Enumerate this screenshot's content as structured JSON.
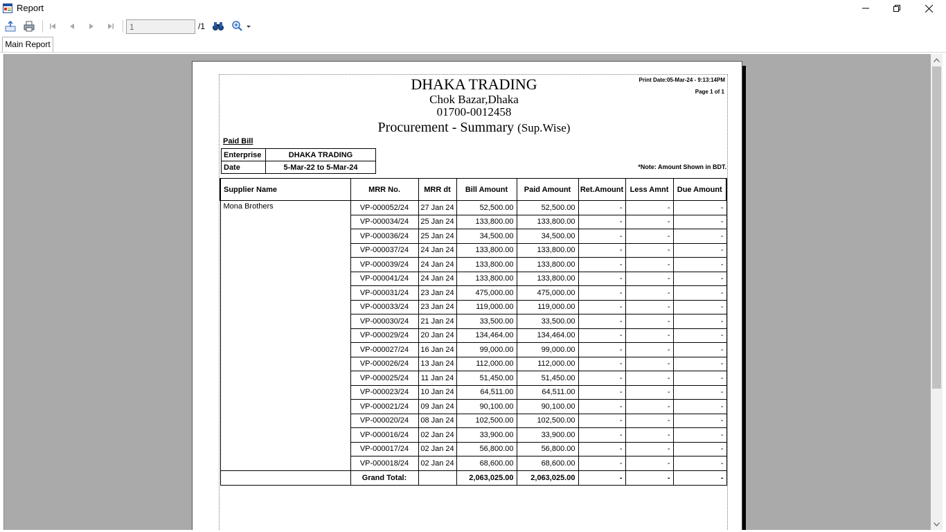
{
  "window": {
    "title": "Report"
  },
  "toolbar": {
    "page_value": "1",
    "page_total": "/1"
  },
  "tabs": [
    {
      "label": "Main Report"
    }
  ],
  "report": {
    "company_name": "DHAKA TRADING",
    "address": "Chok Bazar,Dhaka",
    "phone": "01700-0012458",
    "title_main": "Procurement - Summary",
    "title_sub": "(Sup.Wise)",
    "print_date": "Print Date:05-Mar-24 -  9:13:14PM",
    "page_of": "Page 1 of 1",
    "section_label": "Paid Bill",
    "enterprise_label": "Enterprise",
    "enterprise_value": "DHAKA TRADING",
    "date_label": "Date",
    "date_value": "5-Mar-22 to 5-Mar-24",
    "note": "*Note: Amount Shown in BDT.",
    "columns": [
      "Supplier Name",
      "MRR No.",
      "MRR dt",
      "Bill Amount",
      "Paid Amount",
      "Ret.Amount",
      "Less Amnt",
      "Due Amount"
    ],
    "supplier": "Mona Brothers",
    "rows": [
      {
        "mrr": "VP-000052/24",
        "dt": "27 Jan 24",
        "bill": "52,500.00",
        "paid": "52,500.00",
        "ret": "-",
        "less": "-",
        "due": "-"
      },
      {
        "mrr": "VP-000034/24",
        "dt": "25 Jan 24",
        "bill": "133,800.00",
        "paid": "133,800.00",
        "ret": "-",
        "less": "-",
        "due": "-"
      },
      {
        "mrr": "VP-000036/24",
        "dt": "25 Jan 24",
        "bill": "34,500.00",
        "paid": "34,500.00",
        "ret": "-",
        "less": "-",
        "due": "-"
      },
      {
        "mrr": "VP-000037/24",
        "dt": "24 Jan 24",
        "bill": "133,800.00",
        "paid": "133,800.00",
        "ret": "-",
        "less": "-",
        "due": "-"
      },
      {
        "mrr": "VP-000039/24",
        "dt": "24 Jan 24",
        "bill": "133,800.00",
        "paid": "133,800.00",
        "ret": "-",
        "less": "-",
        "due": "-"
      },
      {
        "mrr": "VP-000041/24",
        "dt": "24 Jan 24",
        "bill": "133,800.00",
        "paid": "133,800.00",
        "ret": "-",
        "less": "-",
        "due": "-"
      },
      {
        "mrr": "VP-000031/24",
        "dt": "23 Jan 24",
        "bill": "475,000.00",
        "paid": "475,000.00",
        "ret": "-",
        "less": "-",
        "due": "-"
      },
      {
        "mrr": "VP-000033/24",
        "dt": "23 Jan 24",
        "bill": "119,000.00",
        "paid": "119,000.00",
        "ret": "-",
        "less": "-",
        "due": "-"
      },
      {
        "mrr": "VP-000030/24",
        "dt": "21 Jan 24",
        "bill": "33,500.00",
        "paid": "33,500.00",
        "ret": "-",
        "less": "-",
        "due": "-"
      },
      {
        "mrr": "VP-000029/24",
        "dt": "20 Jan 24",
        "bill": "134,464.00",
        "paid": "134,464.00",
        "ret": "-",
        "less": "-",
        "due": "-"
      },
      {
        "mrr": "VP-000027/24",
        "dt": "16 Jan 24",
        "bill": "99,000.00",
        "paid": "99,000.00",
        "ret": "-",
        "less": "-",
        "due": "-"
      },
      {
        "mrr": "VP-000026/24",
        "dt": "13 Jan 24",
        "bill": "112,000.00",
        "paid": "112,000.00",
        "ret": "-",
        "less": "-",
        "due": "-"
      },
      {
        "mrr": "VP-000025/24",
        "dt": "11 Jan 24",
        "bill": "51,450.00",
        "paid": "51,450.00",
        "ret": "-",
        "less": "-",
        "due": "-"
      },
      {
        "mrr": "VP-000023/24",
        "dt": "10 Jan 24",
        "bill": "64,511.00",
        "paid": "64,511.00",
        "ret": "-",
        "less": "-",
        "due": "-"
      },
      {
        "mrr": "VP-000021/24",
        "dt": "09 Jan 24",
        "bill": "90,100.00",
        "paid": "90,100.00",
        "ret": "-",
        "less": "-",
        "due": "-"
      },
      {
        "mrr": "VP-000020/24",
        "dt": "08 Jan 24",
        "bill": "102,500.00",
        "paid": "102,500.00",
        "ret": "-",
        "less": "-",
        "due": "-"
      },
      {
        "mrr": "VP-000016/24",
        "dt": "02 Jan 24",
        "bill": "33,900.00",
        "paid": "33,900.00",
        "ret": "-",
        "less": "-",
        "due": "-"
      },
      {
        "mrr": "VP-000017/24",
        "dt": "02 Jan 24",
        "bill": "56,800.00",
        "paid": "56,800.00",
        "ret": "-",
        "less": "-",
        "due": "-"
      },
      {
        "mrr": "VP-000018/24",
        "dt": "02 Jan 24",
        "bill": "68,600.00",
        "paid": "68,600.00",
        "ret": "-",
        "less": "-",
        "due": "-"
      }
    ],
    "total": {
      "label": "Grand Total:",
      "bill": "2,063,025.00",
      "paid": "2,063,025.00",
      "ret": "-",
      "less": "-",
      "due": "-"
    }
  },
  "icons": {
    "app": "report-window-icon",
    "export": "export-icon",
    "print": "print-icon",
    "first": "first-page-icon",
    "prev": "previous-page-icon",
    "next": "next-page-icon",
    "last": "last-page-icon",
    "find": "binoculars-icon",
    "zoom": "zoom-icon"
  }
}
